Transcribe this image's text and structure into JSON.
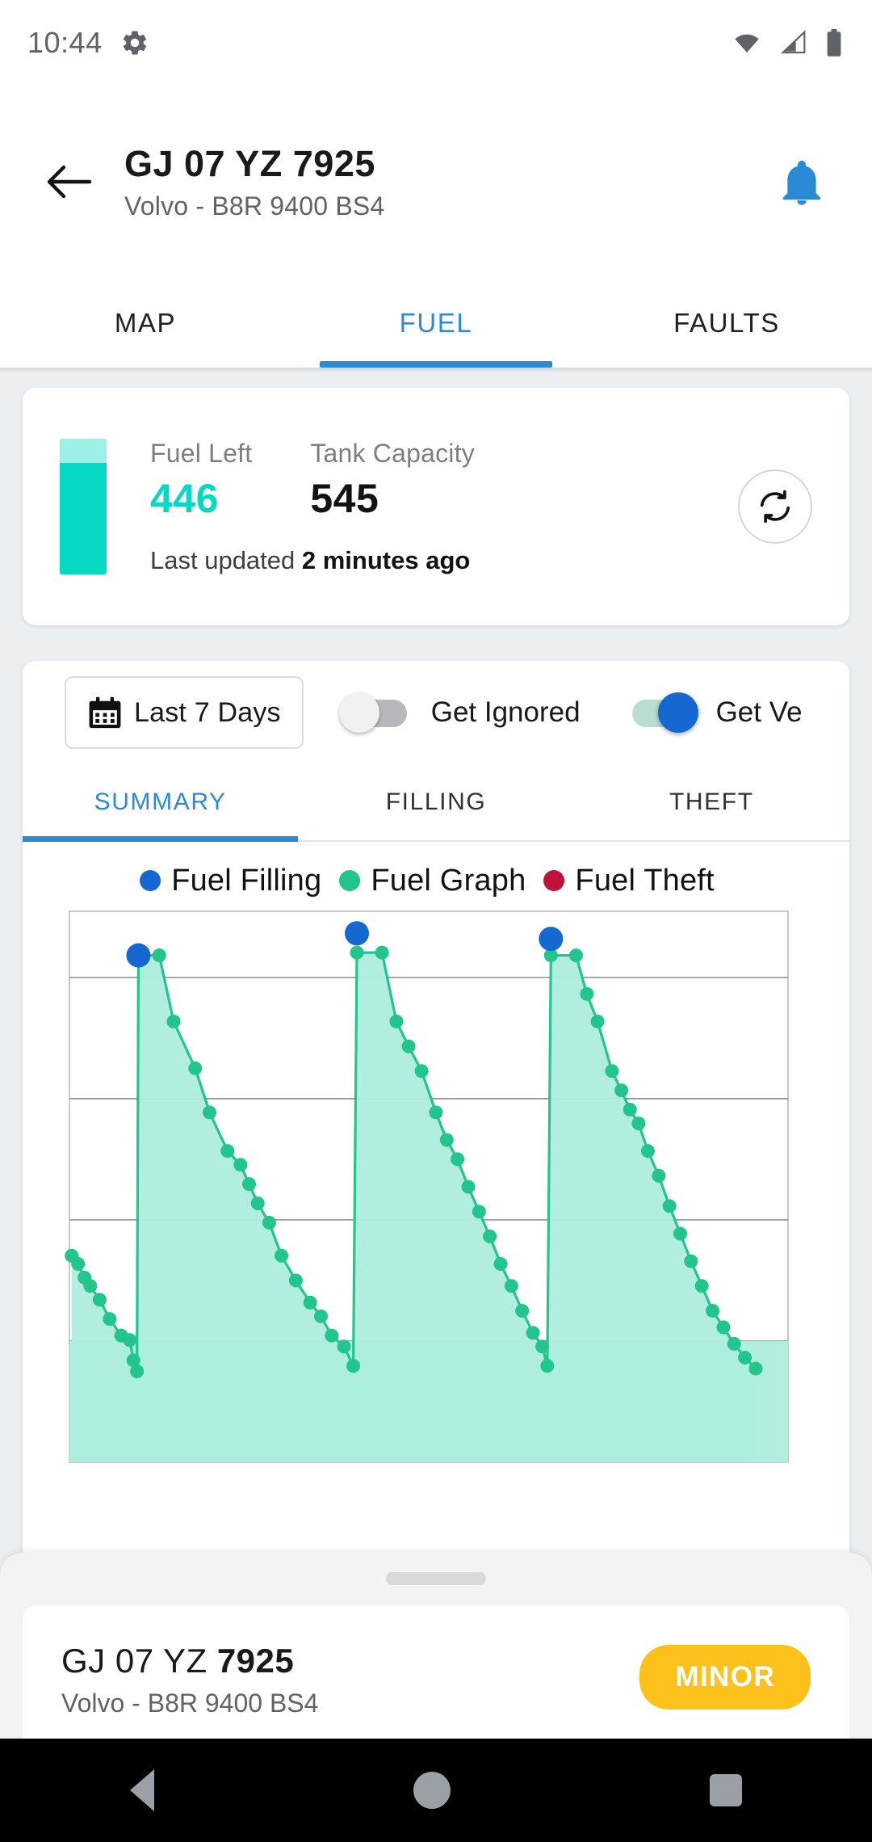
{
  "status_bar": {
    "time": "10:44",
    "icons": [
      "gear-icon",
      "wifi-icon",
      "signal-icon",
      "battery-icon"
    ]
  },
  "header": {
    "back_icon": "arrow-left-icon",
    "title": "GJ 07 YZ 7925",
    "subtitle": "Volvo - B8R 9400 BS4",
    "notification_icon": "bell-icon",
    "notification_color": "#2b8ad6"
  },
  "tabs": [
    {
      "label": "MAP",
      "active": false
    },
    {
      "label": "FUEL",
      "active": true
    },
    {
      "label": "FAULTS",
      "active": false
    }
  ],
  "fuel_card": {
    "gauge_icon": "fuel-gauge-bar",
    "fuel_left_label": "Fuel Left",
    "fuel_left_value": "446",
    "tank_capacity_label": "Tank Capacity",
    "tank_capacity_value": "545",
    "last_updated_prefix": "Last updated",
    "last_updated_value": "2 minutes ago",
    "refresh_icon": "refresh-icon",
    "fill_percent": 82,
    "accent_color": "#05d9c3"
  },
  "filters": {
    "date_range_label": "Last 7 Days",
    "calendar_icon": "calendar-icon",
    "toggles": [
      {
        "label": "Get Ignored",
        "on": false
      },
      {
        "label": "Get Ve",
        "on": true
      }
    ]
  },
  "subtabs": [
    {
      "label": "SUMMARY",
      "active": true
    },
    {
      "label": "FILLING",
      "active": false
    },
    {
      "label": "THEFT",
      "active": false
    }
  ],
  "chart_data": {
    "type": "line",
    "title": "",
    "xlabel": "",
    "ylabel": "",
    "grid": true,
    "legend_position": "top",
    "legend": [
      {
        "label": "Fuel Filling",
        "color": "#1568d0"
      },
      {
        "label": "Fuel Graph",
        "color": "#22c58b"
      },
      {
        "label": "Fuel Theft",
        "color": "#c2123c"
      }
    ],
    "ylim": [
      0,
      100
    ],
    "xlim": [
      0,
      100
    ],
    "gridlines_y": [
      22,
      44,
      66,
      88
    ],
    "series": [
      {
        "name": "Fuel Graph",
        "color": "#22c58b",
        "fill_color": "#aeeddd",
        "points": [
          [
            0.3,
            37.5
          ],
          [
            1.2,
            36.0
          ],
          [
            2.1,
            33.5
          ],
          [
            2.9,
            32.0
          ],
          [
            4.2,
            29.5
          ],
          [
            5.6,
            26.0
          ],
          [
            7.2,
            23.0
          ],
          [
            8.4,
            22.2
          ],
          [
            8.9,
            18.5
          ],
          [
            9.4,
            16.5
          ],
          [
            9.6,
            92.0
          ],
          [
            12.5,
            92.0
          ],
          [
            14.5,
            80.0
          ],
          [
            17.5,
            71.5
          ],
          [
            19.5,
            63.5
          ],
          [
            22.0,
            56.5
          ],
          [
            23.8,
            54.0
          ],
          [
            25.0,
            50.5
          ],
          [
            26.2,
            47.0
          ],
          [
            27.8,
            43.5
          ],
          [
            29.5,
            37.5
          ],
          [
            31.5,
            33.0
          ],
          [
            33.5,
            29.0
          ],
          [
            35.0,
            26.5
          ],
          [
            36.5,
            23.0
          ],
          [
            38.2,
            21.0
          ],
          [
            39.5,
            17.5
          ],
          [
            40.0,
            92.5
          ],
          [
            43.5,
            92.5
          ],
          [
            45.5,
            80.0
          ],
          [
            47.2,
            75.5
          ],
          [
            49.0,
            71.0
          ],
          [
            51.0,
            63.5
          ],
          [
            52.5,
            58.5
          ],
          [
            54.0,
            55.0
          ],
          [
            55.5,
            50.0
          ],
          [
            57.0,
            45.5
          ],
          [
            58.5,
            41.0
          ],
          [
            60.0,
            36.0
          ],
          [
            61.5,
            32.0
          ],
          [
            63.0,
            27.5
          ],
          [
            64.5,
            23.5
          ],
          [
            65.8,
            21.0
          ],
          [
            66.5,
            17.5
          ],
          [
            67.0,
            92.0
          ],
          [
            70.5,
            92.0
          ],
          [
            72.0,
            85.0
          ],
          [
            73.5,
            80.0
          ],
          [
            75.5,
            71.0
          ],
          [
            76.8,
            67.5
          ],
          [
            78.0,
            64.0
          ],
          [
            79.2,
            61.5
          ],
          [
            80.5,
            56.5
          ],
          [
            82.0,
            52.0
          ],
          [
            83.5,
            46.5
          ],
          [
            85.0,
            41.5
          ],
          [
            86.5,
            36.5
          ],
          [
            88.0,
            32.0
          ],
          [
            89.5,
            27.5
          ],
          [
            91.0,
            24.5
          ],
          [
            92.5,
            21.5
          ],
          [
            94.0,
            19.0
          ],
          [
            95.5,
            17.0
          ]
        ]
      }
    ],
    "fill_events": [
      {
        "x": 9.6,
        "y": 92.0,
        "color": "#1568d0"
      },
      {
        "x": 40.0,
        "y": 96.0,
        "color": "#1568d0"
      },
      {
        "x": 67.0,
        "y": 95.0,
        "color": "#1568d0"
      }
    ],
    "theft_events": []
  },
  "bottom_sheet": {
    "handle": "drag-handle",
    "plate_prefix": "GJ 07 YZ ",
    "plate_number": "7925",
    "subtitle": "Volvo - B8R 9400 BS4",
    "badge_label": "MINOR",
    "badge_color": "#fcc21b"
  },
  "nav_bar": {
    "back": "nav-back-icon",
    "home": "nav-home-icon",
    "recents": "nav-recents-icon"
  }
}
